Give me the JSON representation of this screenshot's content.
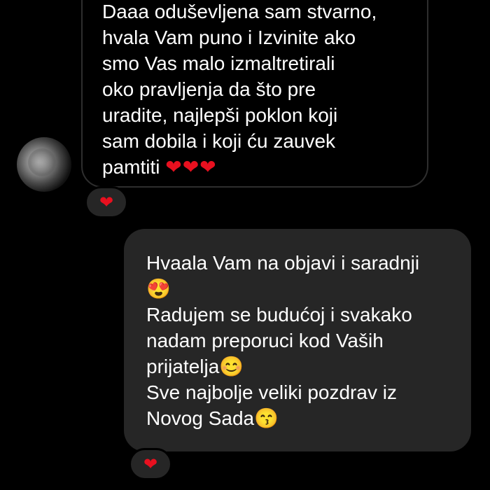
{
  "messages": {
    "received": {
      "text": "Daaa oduševljena sam stvarno,\nhvala Vam puno i Izvinite ako\nsmo Vas malo izmaltretirali\noko pravljenja da što pre\nuradite, najlepši poklon koji\nsam dobila i koji ću zauvek\npamtiti ",
      "trailing_emoji": "❤❤❤",
      "reaction": "❤"
    },
    "sent": {
      "line1": "Hvaala Vam na objavi i saradnji",
      "emoji1": "😍",
      "line2": "Radujem se budućoj i svakako\nnadam preporuci kod Vaših\nprijatelja",
      "emoji2": "😊",
      "line3": "Sve najbolje veliki pozdrav iz\nNovog Sada",
      "emoji3": "😙",
      "reaction": "❤"
    }
  },
  "colors": {
    "background": "#000000",
    "sent_bubble": "#262626",
    "heart": "#e8101f"
  }
}
